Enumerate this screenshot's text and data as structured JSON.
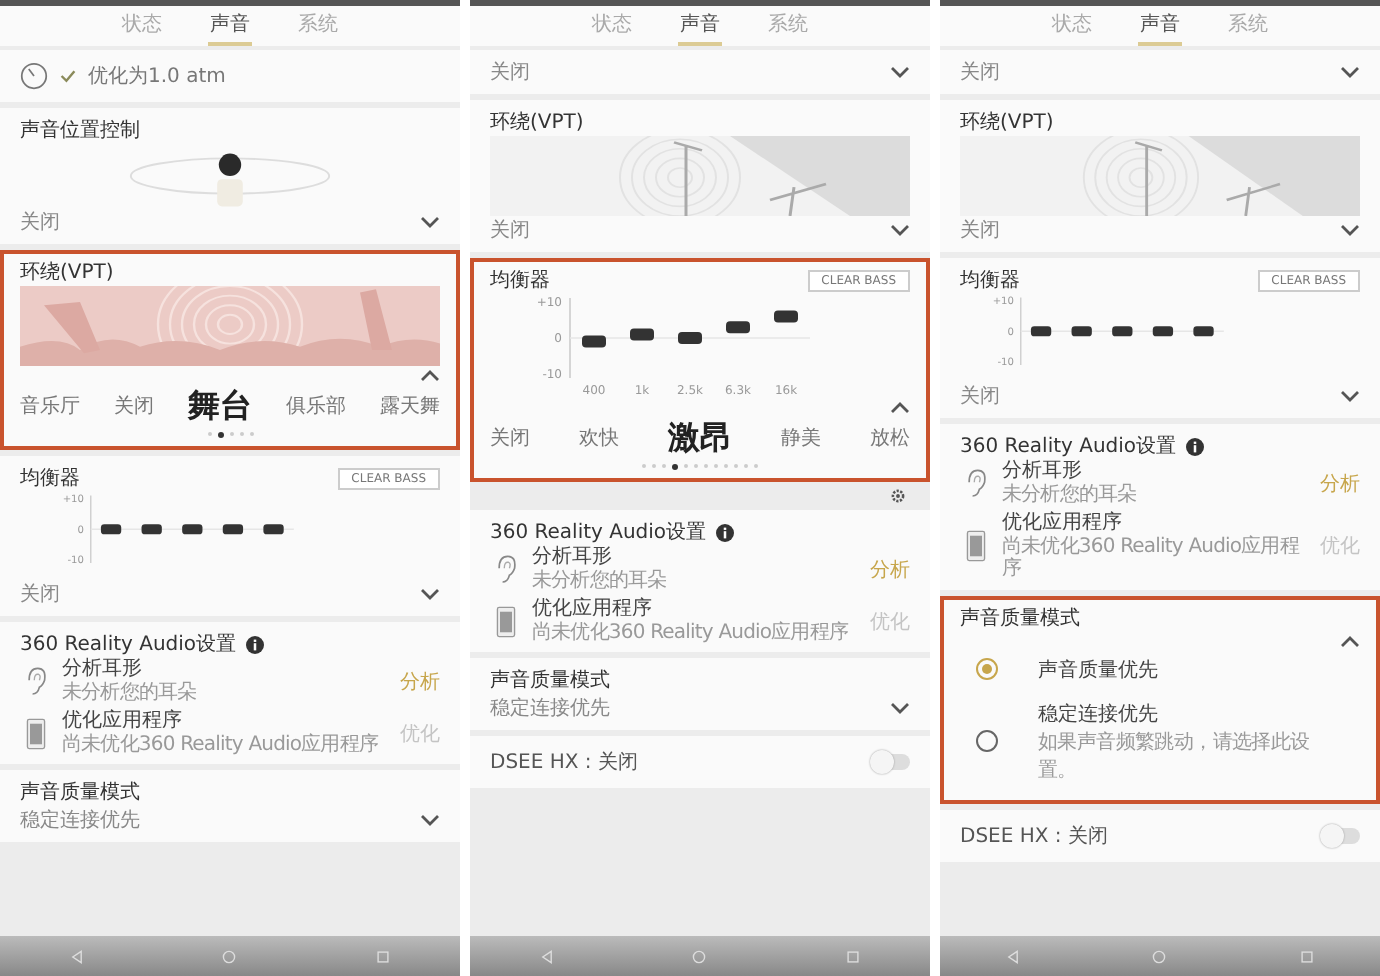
{
  "panels": [
    {
      "tabs": [
        {
          "label": "状态",
          "selected": false
        },
        {
          "label": "声音",
          "selected": true
        },
        {
          "label": "系统",
          "selected": false
        }
      ],
      "sections": [
        {
          "kind": "status",
          "text": "优化为1.0 atm",
          "highlighted": false
        },
        {
          "kind": "position",
          "title": "声音位置控制",
          "value": "关闭",
          "expanded": false,
          "highlighted": false
        },
        {
          "kind": "scene",
          "title": "环绕(VPT)",
          "expanded": true,
          "highlighted": true,
          "options": [
            {
              "label": "音乐厅",
              "selected": false
            },
            {
              "label": "关闭",
              "selected": false
            },
            {
              "label": "舞台",
              "selected": true
            },
            {
              "label": "俱乐部",
              "selected": false
            },
            {
              "label": "露天舞",
              "selected": false
            }
          ],
          "pages": [
            {
              "selected": false
            },
            {
              "selected": true
            },
            {
              "selected": false
            },
            {
              "selected": false
            },
            {
              "selected": false
            }
          ]
        },
        {
          "kind": "equalizer",
          "title": "均衡器",
          "preset": "CLEAR BASS",
          "value": "关闭",
          "expanded": false,
          "highlighted": false,
          "chart_data": {
            "type": "scatter",
            "series": [
              {
                "color": "#333333",
                "values": [
                  0,
                  0,
                  0,
                  0,
                  0
                ]
              }
            ],
            "ylim": [
              -10,
              10
            ],
            "yticks": [
              {
                "value": 10,
                "label": "+10"
              },
              {
                "value": 0,
                "label": "0"
              },
              {
                "value": -10,
                "label": "-10"
              }
            ]
          }
        },
        {
          "kind": "reality",
          "title": "360 Reality Audio设置",
          "highlighted": false,
          "items": [
            {
              "title": "分析耳形",
              "subtitle": "未分析您的耳朵",
              "action": "分析",
              "disabled": false
            },
            {
              "title": "优化应用程序",
              "subtitle": "尚未优化360 Reality Audio应用程序",
              "action": "优化",
              "disabled": true
            }
          ]
        },
        {
          "kind": "quality",
          "title": "声音质量模式",
          "value": "稳定连接优先",
          "expanded": false,
          "highlighted": false
        }
      ]
    },
    {
      "tabs": [
        {
          "label": "状态",
          "selected": false
        },
        {
          "label": "声音",
          "selected": true
        },
        {
          "label": "系统",
          "selected": false
        }
      ],
      "sections": [
        {
          "kind": "dropdown",
          "value": "关闭",
          "expanded": false,
          "highlighted": false
        },
        {
          "kind": "scene",
          "title": "环绕(VPT)",
          "value": "关闭",
          "expanded": false,
          "highlighted": false
        },
        {
          "kind": "equalizer",
          "title": "均衡器",
          "preset": "CLEAR BASS",
          "expanded": true,
          "highlighted": true,
          "chart_data": {
            "type": "scatter",
            "categories": [
              "400",
              "1k",
              "2.5k",
              "6.3k",
              "16k"
            ],
            "series": [
              {
                "color": "#333333",
                "values": [
                  -1,
                  1,
                  0,
                  3,
                  6
                ]
              }
            ],
            "ylim": [
              -10,
              10
            ],
            "yticks": [
              {
                "value": 10,
                "label": "+10"
              },
              {
                "value": 0,
                "label": "0"
              },
              {
                "value": -10,
                "label": "-10"
              }
            ]
          },
          "options": [
            {
              "label": "关闭",
              "selected": false
            },
            {
              "label": "欢快",
              "selected": false
            },
            {
              "label": "激昂",
              "selected": true
            },
            {
              "label": "静美",
              "selected": false
            },
            {
              "label": "放松",
              "selected": false
            }
          ],
          "pages": [
            {
              "selected": false
            },
            {
              "selected": false
            },
            {
              "selected": false
            },
            {
              "selected": true
            },
            {
              "selected": false
            },
            {
              "selected": false
            },
            {
              "selected": false
            },
            {
              "selected": false
            },
            {
              "selected": false
            },
            {
              "selected": false
            },
            {
              "selected": false
            },
            {
              "selected": false
            }
          ]
        },
        {
          "kind": "gear"
        },
        {
          "kind": "reality",
          "title": "360 Reality Audio设置",
          "highlighted": false,
          "items": [
            {
              "title": "分析耳形",
              "subtitle": "未分析您的耳朵",
              "action": "分析",
              "disabled": false
            },
            {
              "title": "优化应用程序",
              "subtitle": "尚未优化360 Reality Audio应用程序",
              "action": "优化",
              "disabled": true
            }
          ]
        },
        {
          "kind": "quality",
          "title": "声音质量模式",
          "value": "稳定连接优先",
          "expanded": false,
          "highlighted": false
        },
        {
          "kind": "switch",
          "label": "DSEE HX : 关闭",
          "on": false,
          "highlighted": false
        }
      ]
    },
    {
      "tabs": [
        {
          "label": "状态",
          "selected": false
        },
        {
          "label": "声音",
          "selected": true
        },
        {
          "label": "系统",
          "selected": false
        }
      ],
      "sections": [
        {
          "kind": "dropdown",
          "value": "关闭",
          "expanded": false,
          "highlighted": false
        },
        {
          "kind": "scene",
          "title": "环绕(VPT)",
          "value": "关闭",
          "expanded": false,
          "highlighted": false
        },
        {
          "kind": "equalizer",
          "title": "均衡器",
          "preset": "CLEAR BASS",
          "value": "关闭",
          "expanded": false,
          "highlighted": false,
          "chart_data": {
            "type": "scatter",
            "series": [
              {
                "color": "#333333",
                "values": [
                  0,
                  0,
                  0,
                  0,
                  0
                ]
              }
            ],
            "ylim": [
              -10,
              10
            ],
            "yticks": [
              {
                "value": 10,
                "label": "+10"
              },
              {
                "value": 0,
                "label": "0"
              },
              {
                "value": -10,
                "label": "-10"
              }
            ]
          }
        },
        {
          "kind": "reality",
          "title": "360 Reality Audio设置",
          "highlighted": false,
          "items": [
            {
              "title": "分析耳形",
              "subtitle": "未分析您的耳朵",
              "action": "分析",
              "disabled": false
            },
            {
              "title": "优化应用程序",
              "subtitle": "尚未优化360 Reality Audio应用程序",
              "action": "优化",
              "disabled": true
            }
          ]
        },
        {
          "kind": "quality",
          "title": "声音质量模式",
          "expanded": true,
          "highlighted": true,
          "options": [
            {
              "label": "声音质量优先",
              "selected": true
            },
            {
              "label": "稳定连接优先",
              "description": "如果声音频繁跳动，请选择此设置。",
              "selected": false
            }
          ]
        },
        {
          "kind": "switch",
          "label": "DSEE HX : 关闭",
          "on": false,
          "highlighted": false
        }
      ]
    }
  ]
}
